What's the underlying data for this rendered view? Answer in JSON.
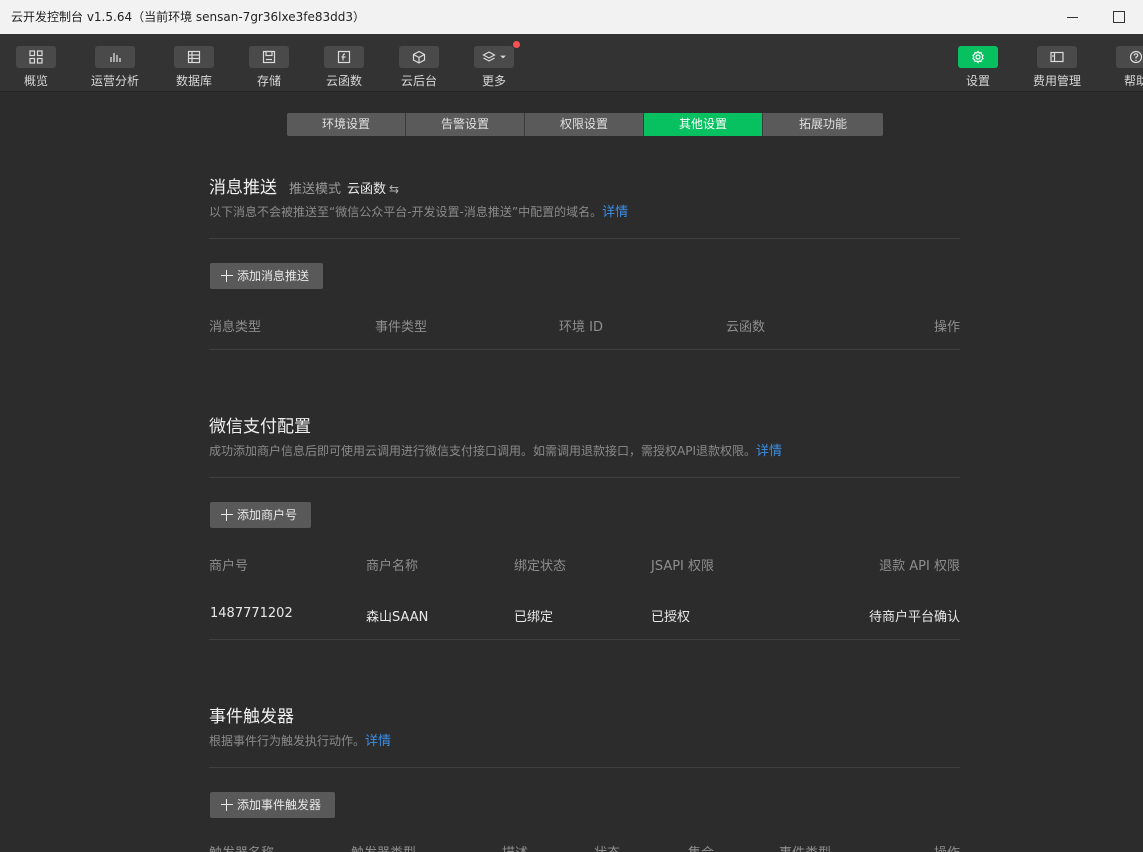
{
  "window": {
    "title": "云开发控制台 v1.5.64（当前环境 sensan-7gr36lxe3fe83dd3）"
  },
  "toolbar": {
    "left": [
      {
        "label": "概览",
        "icon": "grid-icon"
      },
      {
        "label": "运营分析",
        "icon": "bar-chart-icon"
      },
      {
        "label": "数据库",
        "icon": "database-icon"
      },
      {
        "label": "存储",
        "icon": "storage-icon"
      },
      {
        "label": "云函数",
        "icon": "function-icon"
      },
      {
        "label": "云后台",
        "icon": "cube-icon"
      },
      {
        "label": "更多",
        "icon": "layers-icon"
      }
    ],
    "right": [
      {
        "label": "设置",
        "icon": "gear-icon"
      },
      {
        "label": "费用管理",
        "icon": "billing-icon"
      },
      {
        "label": "帮助",
        "icon": "help-icon"
      }
    ],
    "accent": "#07c160",
    "badge_color": "#fa5151"
  },
  "tabs": [
    "环境设置",
    "告警设置",
    "权限设置",
    "其他设置",
    "拓展功能"
  ],
  "selected_tab": "其他设置",
  "push": {
    "title": "消息推送",
    "mode_label": "推送模式",
    "mode_value": "云函数",
    "mode_icon": "⇆",
    "desc": "以下消息不会被推送至“微信公众平台-开发设置-消息推送”中配置的域名。",
    "detail_link": "详情",
    "add_button": "添加消息推送",
    "columns": [
      "消息类型",
      "事件类型",
      "环境 ID",
      "云函数",
      "操作"
    ]
  },
  "pay": {
    "title": "微信支付配置",
    "desc": "成功添加商户信息后即可使用云调用进行微信支付接口调用。如需调用退款接口，需授权API退款权限。",
    "detail_link": "详情",
    "add_button": "添加商户号",
    "columns": [
      "商户号",
      "商户名称",
      "绑定状态",
      "JSAPI 权限",
      "退款 API 权限"
    ],
    "rows": [
      {
        "merchant_id": "1487771202",
        "merchant_name": "森山SAAN",
        "bind_status": "已绑定",
        "jsapi": "已授权",
        "refund_api": "待商户平台确认"
      }
    ]
  },
  "trigger": {
    "title": "事件触发器",
    "desc": "根据事件行为触发执行动作。",
    "detail_link": "详情",
    "add_button": "添加事件触发器",
    "columns": [
      "触发器名称",
      "触发器类型",
      "描述",
      "状态",
      "集合",
      "事件类型",
      "操作"
    ]
  }
}
